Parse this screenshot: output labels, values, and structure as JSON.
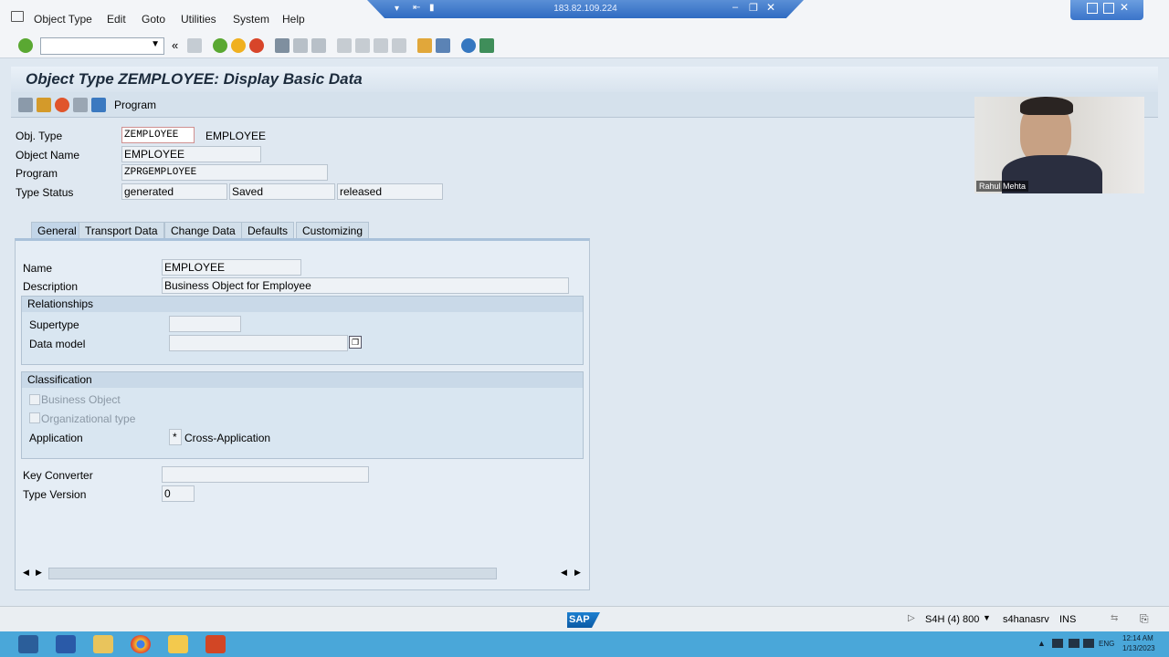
{
  "menu": {
    "items": [
      "Object Type",
      "Edit",
      "Goto",
      "Utilities",
      "System",
      "Help"
    ]
  },
  "remote": {
    "ip": "183.82.109.224"
  },
  "page": {
    "title": "Object Type ZEMPLOYEE: Display Basic Data"
  },
  "app_toolbar": {
    "program_label": "Program"
  },
  "header_fields": {
    "obj_type_label": "Obj. Type",
    "obj_type_value": "ZEMPLOYEE",
    "obj_type_desc": "EMPLOYEE",
    "object_name_label": "Object Name",
    "object_name_value": "EMPLOYEE",
    "program_label": "Program",
    "program_value": "ZPRGEMPLOYEE",
    "type_status_label": "Type Status",
    "status_1": "generated",
    "status_2": "Saved",
    "status_3": "released"
  },
  "tabs": [
    {
      "label": "General",
      "active": true
    },
    {
      "label": "Transport Data",
      "active": false
    },
    {
      "label": "Change Data",
      "active": false
    },
    {
      "label": "Defaults",
      "active": false
    },
    {
      "label": "Customizing",
      "active": false
    }
  ],
  "general": {
    "name_label": "Name",
    "name_value": "EMPLOYEE",
    "description_label": "Description",
    "description_value": "Business Object for Employee",
    "relationships_title": "Relationships",
    "supertype_label": "Supertype",
    "supertype_value": "",
    "data_model_label": "Data model",
    "data_model_value": "",
    "classification_title": "Classification",
    "business_object_label": "Business Object",
    "org_type_label": "Organizational type",
    "application_label": "Application",
    "application_code": "*",
    "application_value": "Cross-Application",
    "key_converter_label": "Key Converter",
    "key_converter_value": "",
    "type_version_label": "Type Version",
    "type_version_value": "0"
  },
  "webcam": {
    "name": "Rahul Mehta"
  },
  "status_bar": {
    "logo": "SAP",
    "system": "S4H (4) 800",
    "server": "s4hanasrv",
    "mode": "INS"
  },
  "taskbar": {
    "lang": "ENG",
    "time": "12:14 AM",
    "date": "1/13/2023"
  },
  "colors": {
    "accent": "#4aa7d9",
    "title_bg": "#d8e3ee",
    "panel_bg": "#e5edf5"
  }
}
